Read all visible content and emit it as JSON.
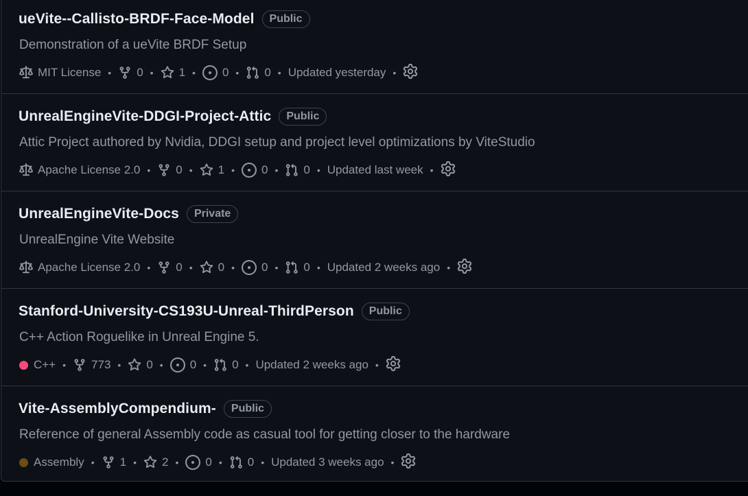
{
  "repos": [
    {
      "name": "ueVite--Callisto-BRDF-Face-Model",
      "visibility": "Public",
      "description": "Demonstration of a ueVite BRDF Setup",
      "license": "MIT License",
      "forks": "0",
      "stars": "1",
      "issues": "0",
      "pulls": "0",
      "updated": "Updated yesterday"
    },
    {
      "name": "UnrealEngineVite-DDGI-Project-Attic",
      "visibility": "Public",
      "description": "Attic Project authored by Nvidia, DDGI setup and project level optimizations by ViteStudio",
      "license": "Apache License 2.0",
      "forks": "0",
      "stars": "1",
      "issues": "0",
      "pulls": "0",
      "updated": "Updated last week"
    },
    {
      "name": "UnrealEngineVite-Docs",
      "visibility": "Private",
      "description": "UnrealEngine Vite Website",
      "license": "Apache License 2.0",
      "forks": "0",
      "stars": "0",
      "issues": "0",
      "pulls": "0",
      "updated": "Updated 2 weeks ago"
    },
    {
      "name": "Stanford-University-CS193U-Unreal-ThirdPerson",
      "visibility": "Public",
      "description": "C++ Action Roguelike in Unreal Engine 5.",
      "language": "C++",
      "language_color": "#f34b7d",
      "forks": "773",
      "stars": "0",
      "issues": "0",
      "pulls": "0",
      "updated": "Updated 2 weeks ago"
    },
    {
      "name": "Vite-AssemblyCompendium-",
      "visibility": "Public",
      "description": "Reference of general Assembly code as casual tool for getting closer to the hardware",
      "language": "Assembly",
      "language_color": "#6e4c13",
      "forks": "1",
      "stars": "2",
      "issues": "0",
      "pulls": "0",
      "updated": "Updated 3 weeks ago"
    }
  ],
  "icons": {
    "license": "law-icon",
    "forks": "repo-forked-icon",
    "stars": "star-icon",
    "issues": "issue-opened-icon",
    "pulls": "git-pull-request-icon",
    "settings": "gear-icon"
  },
  "colors": {
    "background": "#0d1117",
    "border": "#30363d",
    "title": "#e6edf3",
    "muted": "#9198a1"
  }
}
